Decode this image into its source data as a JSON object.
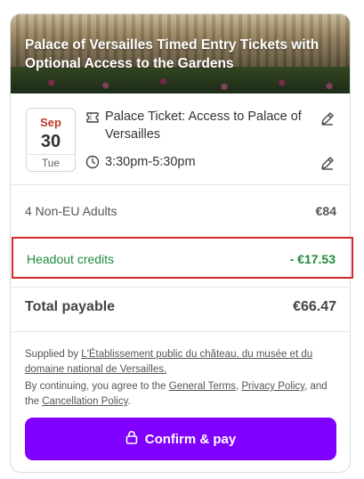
{
  "hero": {
    "title": "Palace of Versailles Timed Entry Tickets with Optional Access to the Gardens"
  },
  "booking": {
    "date": {
      "month": "Sep",
      "day": "30",
      "weekday": "Tue"
    },
    "ticket_name": "Palace Ticket: Access to Palace of Versailles",
    "time": "3:30pm-5:30pm",
    "icons": [
      "ticket-icon",
      "clock-icon",
      "edit-icon"
    ]
  },
  "summary": {
    "guests_label": "4 Non-EU Adults",
    "guests_price": "€84",
    "credits_label": "Headout credits",
    "credits_value": "- €17.53",
    "total_label": "Total payable",
    "total_value": "€66.47"
  },
  "legal": {
    "supplied_prefix": "Supplied by ",
    "supplier_name": "L'Établissement public du château, du musée et du domaine national de Versailles.",
    "agree_prefix": "By continuing, you agree to the ",
    "general_terms": "General Terms",
    "comma": ", ",
    "privacy_policy": "Privacy Policy",
    "and_the": ", and the ",
    "cancellation_policy": "Cancellation Policy",
    "period": "."
  },
  "cta": {
    "label": "Confirm & pay",
    "icon": "lock-icon"
  },
  "colors": {
    "accent": "#8000ff",
    "credits_green": "#1f8a3a",
    "highlight_red": "#d42a2a",
    "month_red": "#c0392b"
  }
}
